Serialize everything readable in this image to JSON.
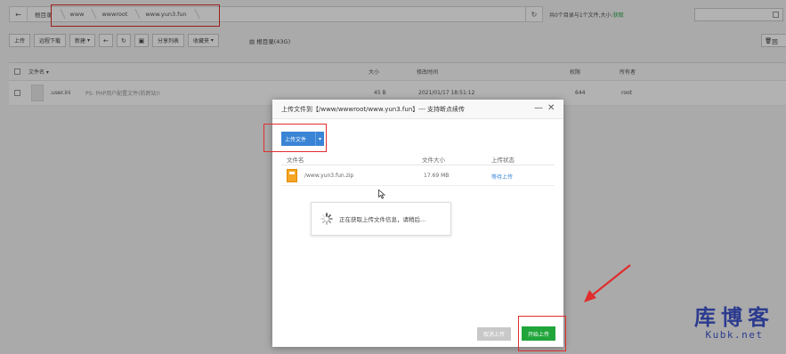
{
  "pathbar": {
    "crumbs": [
      "根目录",
      "www",
      "wwwroot",
      "www.yun3.fun"
    ]
  },
  "dir_info": {
    "text": "共0个目录与1个文件,大小:",
    "link": "获取"
  },
  "toolbar": {
    "upload": "上传",
    "remote_download": "远程下载",
    "new": "新建",
    "share_list": "分享列表",
    "favorites": "收藏夹",
    "disk": "根目录(43G)",
    "recycle": "回"
  },
  "table": {
    "headers": {
      "name": "文件名",
      "size": "大小",
      "mtime": "修改时间",
      "perm": "权限",
      "owner": "所有者"
    },
    "rows": [
      {
        "name": ".user.ini",
        "note": "PS: PHP用户配置文件(防跨站)!",
        "size": "45 B",
        "mtime": "2021/01/17 18:51:12",
        "perm": "644",
        "owner": "root"
      }
    ]
  },
  "dialog": {
    "title": "上传文件到【/www/wwwroot/www.yun3.fun】--- 支持断点续传",
    "upload_button": "上传文件",
    "columns": {
      "name": "文件名",
      "size": "文件大小",
      "status": "上传状态"
    },
    "file": {
      "name": "/www.yun3.fun.zip",
      "size": "17.69 MB",
      "status": "等待上传"
    },
    "loading_text": "正在获取上传文件信息，请稍后...",
    "cancel_button": "取消上传",
    "start_button": "开始上传"
  },
  "watermark": {
    "cn": "库博客",
    "en": "Kubk.net"
  },
  "colors": {
    "accent_green": "#20a53a",
    "accent_blue": "#3a84d6",
    "highlight_red": "#e02d2d",
    "watermark": "#2c3b8f"
  }
}
